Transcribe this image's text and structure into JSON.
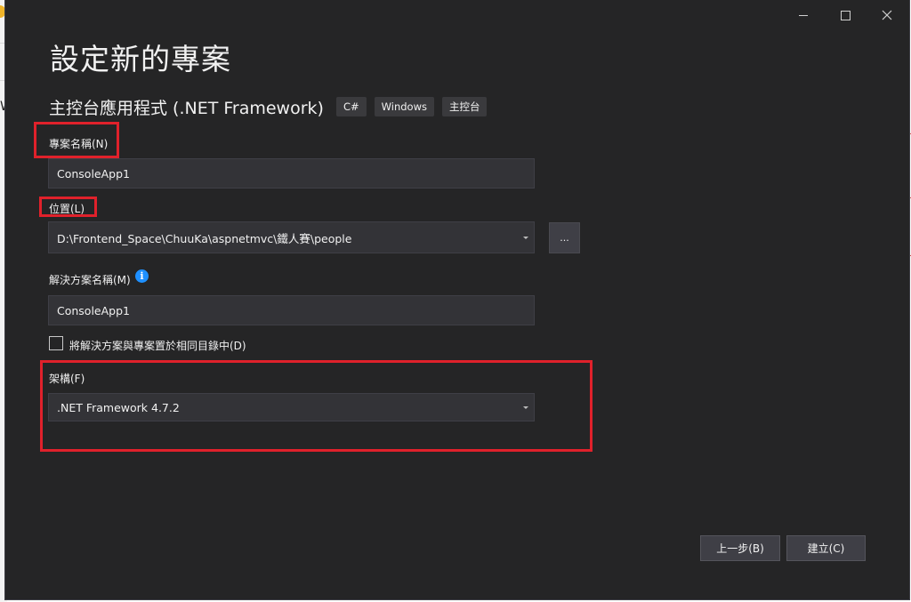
{
  "background": {
    "partial_text": "W"
  },
  "window": {
    "controls": [
      "minimize",
      "maximize",
      "close"
    ]
  },
  "title": "設定新的專案",
  "template": {
    "name": "主控台應用程式 (.NET Framework)",
    "tags": [
      "C#",
      "Windows",
      "主控台"
    ]
  },
  "project_name": {
    "label": "專案名稱(N)",
    "value": "ConsoleApp1"
  },
  "location": {
    "label": "位置(L)",
    "value": "D:\\Frontend_Space\\ChuuKa\\aspnetmvc\\鐵人賽\\people",
    "browse_label": "..."
  },
  "solution_name": {
    "label": "解決方案名稱(M)",
    "value": "ConsoleApp1",
    "info_icon": "info-icon"
  },
  "same_dir_checkbox": {
    "label": "將解決方案與專案置於相同目錄中(D)",
    "checked": false
  },
  "framework": {
    "label": "架構(F)",
    "value": ".NET Framework 4.7.2"
  },
  "buttons": {
    "back": "上一步(B)",
    "create": "建立(C)"
  },
  "colors": {
    "dialog_bg": "#252526",
    "field_bg": "#333337",
    "highlight": "#e0212b",
    "info": "#1e90ff"
  }
}
